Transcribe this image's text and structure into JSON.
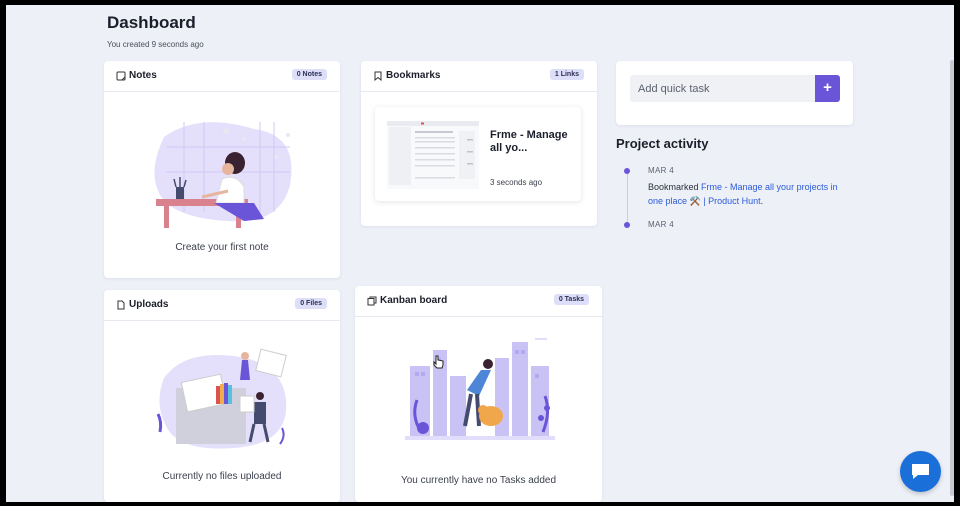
{
  "header": {
    "title": "Dashboard",
    "subtitle": "You created 9 seconds ago"
  },
  "notes": {
    "title": "Notes",
    "badge": "0 Notes",
    "empty_text": "Create your first note"
  },
  "bookmarks": {
    "title": "Bookmarks",
    "badge": "1 Links",
    "item": {
      "title": "Frme - Manage all yo...",
      "time": "3 seconds ago"
    }
  },
  "uploads": {
    "title": "Uploads",
    "badge": "0 Files",
    "empty_text": "Currently no files uploaded"
  },
  "kanban": {
    "title": "Kanban board",
    "badge": "0 Tasks",
    "empty_text": "You currently have no Tasks added"
  },
  "quick_task": {
    "placeholder": "Add quick task",
    "button_label": "+"
  },
  "activity": {
    "title": "Project activity",
    "entries": [
      {
        "date": "MAR 4",
        "prefix": "Bookmarked ",
        "link": "Frme - Manage all your projects in one place ⚒️  | Product Hunt",
        "suffix": "."
      },
      {
        "date": "MAR 4"
      }
    ]
  },
  "colors": {
    "accent": "#6a55d8",
    "link": "#2a5bd7",
    "chat": "#1a6fd8",
    "background": "#eef0f8"
  },
  "icons": [
    "notes-icon",
    "bookmark-icon",
    "file-icon",
    "kanban-icon",
    "plus-icon",
    "chat-icon"
  ]
}
